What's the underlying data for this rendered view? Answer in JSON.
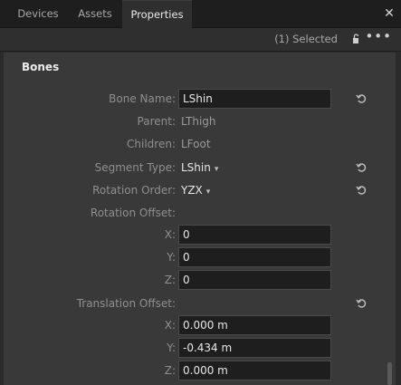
{
  "tabs": [
    {
      "label": "Devices"
    },
    {
      "label": "Assets"
    },
    {
      "label": "Properties"
    }
  ],
  "toolbar": {
    "selected_text": "(1) Selected",
    "lock_icon": "lock-icon",
    "more_icon": "more-options-icon",
    "more_glyph": "•••"
  },
  "close_glyph": "✕",
  "section": {
    "title": "Bones"
  },
  "fields": {
    "bone_name": {
      "label": "Bone Name:",
      "value": "LShin"
    },
    "parent": {
      "label": "Parent:",
      "value": "LThigh"
    },
    "children": {
      "label": "Children:",
      "value": "LFoot"
    },
    "segment_type": {
      "label": "Segment Type:",
      "value": "LShin"
    },
    "rotation_order": {
      "label": "Rotation Order:",
      "value": "YZX"
    },
    "rotation_offset": {
      "label": "Rotation Offset:",
      "x": {
        "label": "X:",
        "value": "0"
      },
      "y": {
        "label": "Y:",
        "value": "0"
      },
      "z": {
        "label": "Z:",
        "value": "0"
      }
    },
    "translation_offset": {
      "label": "Translation Offset:",
      "x": {
        "label": "X:",
        "value": "0.000 m"
      },
      "y": {
        "label": "Y:",
        "value": "-0.434 m"
      },
      "z": {
        "label": "Z:",
        "value": "0.000 m"
      }
    }
  },
  "colors": {
    "background": "#2b2b2b",
    "panel": "#393939",
    "field_bg": "#1e1e1e",
    "text_light": "#e6e6e6",
    "text_muted": "#8f8f8f"
  }
}
